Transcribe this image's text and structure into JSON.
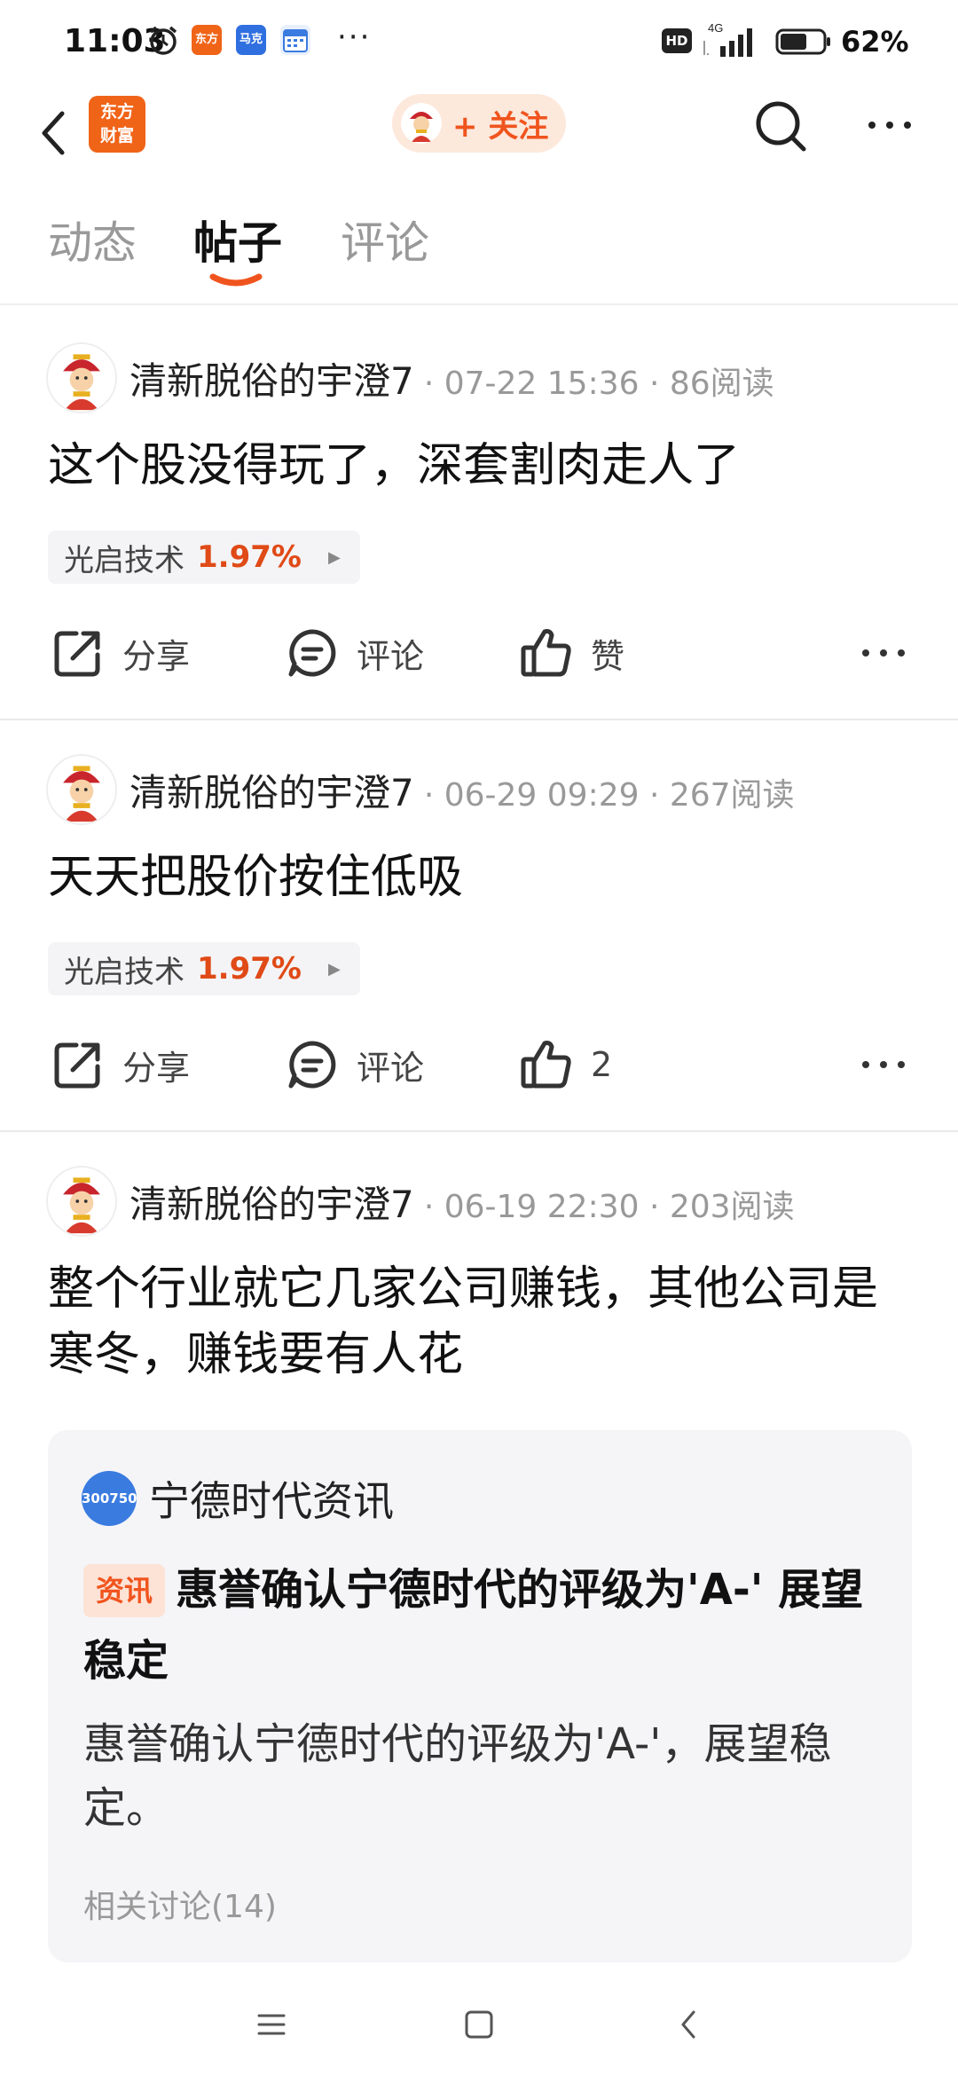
{
  "status_bar": {
    "time": "11:03",
    "app_icon_1": "东方",
    "app_icon_2": "马克",
    "overflow": "···",
    "hd": "HD",
    "network": "4G",
    "battery": "62%",
    "battery_level": 0.62
  },
  "nav": {
    "logo_line1": "东方",
    "logo_line2": "财富",
    "follow_label": "+ 关注",
    "icons": [
      "back-arrow-icon",
      "search-icon",
      "more-horizontal-icon"
    ]
  },
  "tabs": [
    {
      "label": "动态",
      "active": false
    },
    {
      "label": "帖子",
      "active": true
    },
    {
      "label": "评论",
      "active": false
    }
  ],
  "posts": [
    {
      "author": "清新脱俗的宇澄7",
      "meta": "· 07-22 15:36 · 86阅读",
      "text": "这个股没得玩了，深套割肉走人了",
      "stock_name": "光启技术",
      "stock_change": "1.97%",
      "share_label": "分享",
      "comment_label": "评论",
      "like_label": "赞"
    },
    {
      "author": "清新脱俗的宇澄7",
      "meta": "· 06-29 09:29 · 267阅读",
      "text": "天天把股价按住低吸",
      "stock_name": "光启技术",
      "stock_change": "1.97%",
      "share_label": "分享",
      "comment_label": "评论",
      "like_label": "2"
    },
    {
      "author": "清新脱俗的宇澄7",
      "meta": "· 06-19 22:30 · 203阅读",
      "text": "整个行业就它几家公司赚钱，其他公司是寒冬，赚钱要有人花"
    }
  ],
  "news_card": {
    "source_code": "300750",
    "source_name": "宁德时代资讯",
    "badge": "资讯",
    "title": "惠誉确认宁德时代的评级为'A-' 展望稳定",
    "summary": "惠誉确认宁德时代的评级为'A-'，展望稳定。",
    "related": "相关讨论(14)"
  },
  "colors": {
    "accent": "#f0541e",
    "logo_bg": "#f06418",
    "stock_up": "#e04a16",
    "muted_text": "#999999"
  }
}
